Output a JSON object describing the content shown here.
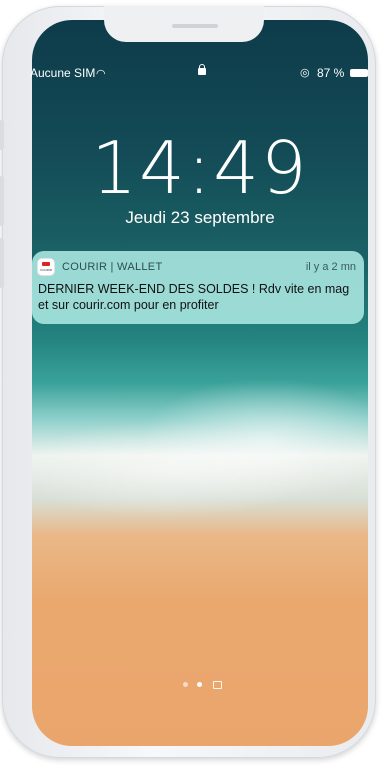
{
  "status_bar": {
    "carrier": "Aucune SIM",
    "wifi_icon": "wifi-icon",
    "lock_icon": "lock-icon",
    "rotation_icon": "rotation-lock-icon",
    "battery_percent": "87 %",
    "battery_icon": "battery-icon"
  },
  "lock_screen": {
    "time": "14:49",
    "date": "Jeudi 23 septembre"
  },
  "notification": {
    "app_name": "COURIR | WALLET",
    "app_icon_text": "COURIR",
    "time_ago": "il y a 2 mn",
    "message": "DERNIER WEEK-END DES SOLDES ! Rdv vite en mag et sur courir.com pour en profiter"
  },
  "page_dots": {
    "count": 2,
    "active_index": 1,
    "camera_icon": "camera-icon"
  }
}
